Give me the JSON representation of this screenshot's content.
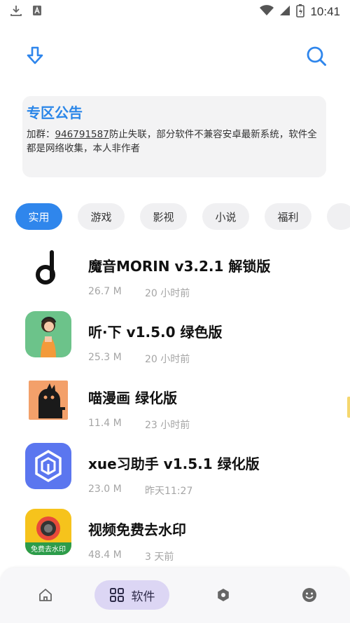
{
  "status_bar": {
    "time": "10:41"
  },
  "notice": {
    "title": "专区公告",
    "prefix": "加群：",
    "qq": "946791587",
    "suffix": "防止失联，部分软件不兼容安卓最新系统，软件全都是网络收集，本人非作者"
  },
  "categories": [
    {
      "label": "实用",
      "active": true
    },
    {
      "label": "游戏"
    },
    {
      "label": "影视"
    },
    {
      "label": "小说"
    },
    {
      "label": "福利"
    }
  ],
  "apps": [
    {
      "name": "魔音MORIN v3.2.1 解锁版",
      "size": "26.7 M",
      "time": "20 小时前",
      "icon": "moyin-logo-icon"
    },
    {
      "name": "听·下 v1.5.0 绿色版",
      "size": "25.3 M",
      "time": "20 小时前",
      "icon": "tingxia-logo-icon"
    },
    {
      "name": "喵漫画  绿化版",
      "size": "11.4 M",
      "time": "23 小时前",
      "icon": "miaomanhua-logo-icon"
    },
    {
      "name": "xue习助手 v1.5.1 绿化版",
      "size": "23.0 M",
      "time": "昨天11:27",
      "icon": "xuexi-logo-icon"
    },
    {
      "name": "视频免费去水印",
      "size": "48.4 M",
      "time": "3 天前",
      "icon": "watermark-logo-icon",
      "icon_text": "免费去水印"
    }
  ],
  "nav": {
    "apps_label": "软件"
  },
  "colors": {
    "accent": "#2f86ec",
    "notice_title": "#2a86e8",
    "nav_active_bg": "#dcd6f4"
  }
}
